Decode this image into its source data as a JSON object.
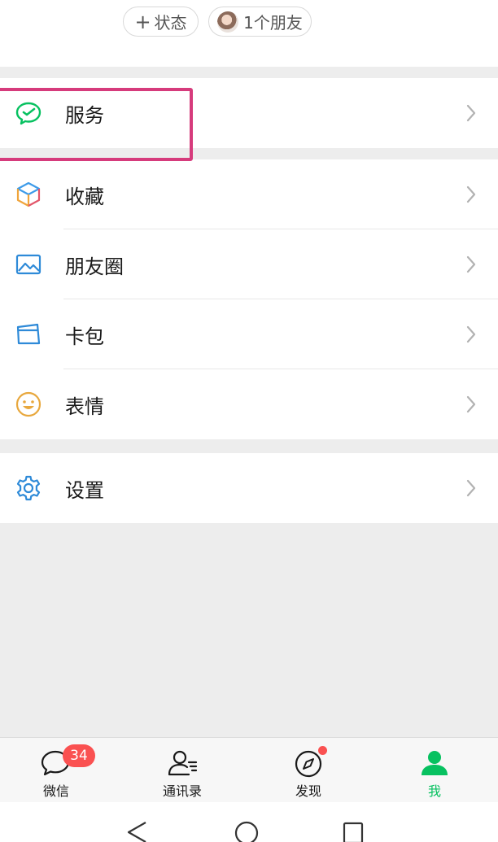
{
  "header": {
    "status_chip": {
      "label": "状态",
      "icon": "plus-icon"
    },
    "friends_chip": {
      "label": "1个朋友",
      "icon": "avatar"
    }
  },
  "menu": {
    "service": {
      "label": "服务",
      "icon": "wechat-pay-icon"
    },
    "favorites": {
      "label": "收藏",
      "icon": "cube-icon"
    },
    "moments": {
      "label": "朋友圈",
      "icon": "image-icon"
    },
    "cards": {
      "label": "卡包",
      "icon": "card-icon"
    },
    "stickers": {
      "label": "表情",
      "icon": "smiley-icon"
    },
    "settings": {
      "label": "设置",
      "icon": "gear-icon"
    }
  },
  "tabbar": {
    "chats": {
      "label": "微信",
      "badge": "34"
    },
    "contacts": {
      "label": "通讯录"
    },
    "discover": {
      "label": "发现",
      "has_dot": true
    },
    "me": {
      "label": "我",
      "active": true
    }
  },
  "colors": {
    "accent": "#07c160",
    "badge": "#fa5151",
    "highlight": "#d63b7c"
  }
}
